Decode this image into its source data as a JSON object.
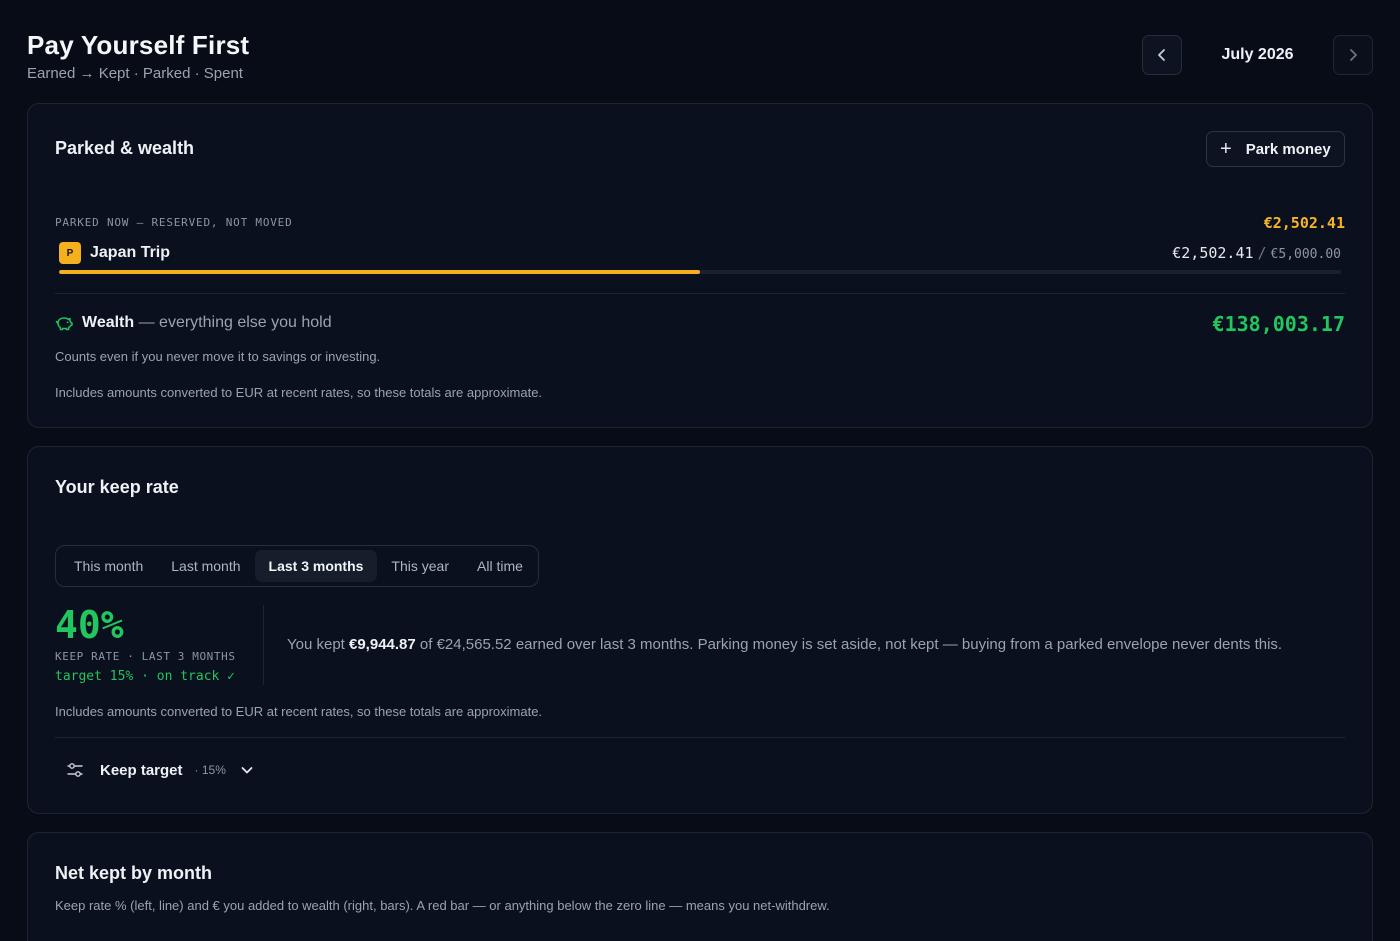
{
  "header": {
    "title": "Pay Yourself First",
    "subtitle": "Earned → Kept · Parked · Spent",
    "month": "July 2026",
    "prev_icon": "chevron-left-icon",
    "next_icon": "chevron-right-icon"
  },
  "parked": {
    "title": "Parked & wealth",
    "park_button": "Park money",
    "label": "PARKED NOW — RESERVED, NOT MOVED",
    "total": "€2,502.41",
    "envelope": {
      "badge": "P",
      "name": "Japan Trip",
      "amount": "€2,502.41",
      "separator": "/",
      "goal": "€5,000.00",
      "progress": 0.5
    },
    "wealth": {
      "label": "Wealth",
      "suffix": "— everything else you hold",
      "amount": "€138,003.17",
      "note": "Counts even if you never move it to savings or investing.",
      "icon": "piggy-bank-icon"
    },
    "disclaimer": "Includes amounts converted to EUR at recent rates, so these totals are approximate."
  },
  "keep_rate": {
    "title": "Your keep rate",
    "tabs": [
      "This month",
      "Last month",
      "Last 3 months",
      "This year",
      "All time"
    ],
    "active_tab": "Last 3 months",
    "rate": "40%",
    "rate_label": "KEEP RATE · LAST 3 MONTHS",
    "target_status": "target 15% · on track ✓",
    "summary": {
      "prefix": "You kept ",
      "kept": "€9,944.87",
      "middle": " of €24,565.52 earned over last 3 months. Parking money is set aside, not kept — buying from a parked envelope never dents this."
    },
    "disclaimer": "Includes amounts converted to EUR at recent rates, so these totals are approximate.",
    "keep_target": {
      "label": "Keep target",
      "value": "· 15%"
    }
  },
  "net_kept": {
    "title": "Net kept by month",
    "description": "Keep rate % (left, line) and € you added to wealth (right, bars). A red bar — or anything below the zero line — means you net-withdrew."
  },
  "colors": {
    "background": "#070c17",
    "card": "#0a101d",
    "accent_green": "#22c55e",
    "accent_amber": "#f5b01e"
  }
}
